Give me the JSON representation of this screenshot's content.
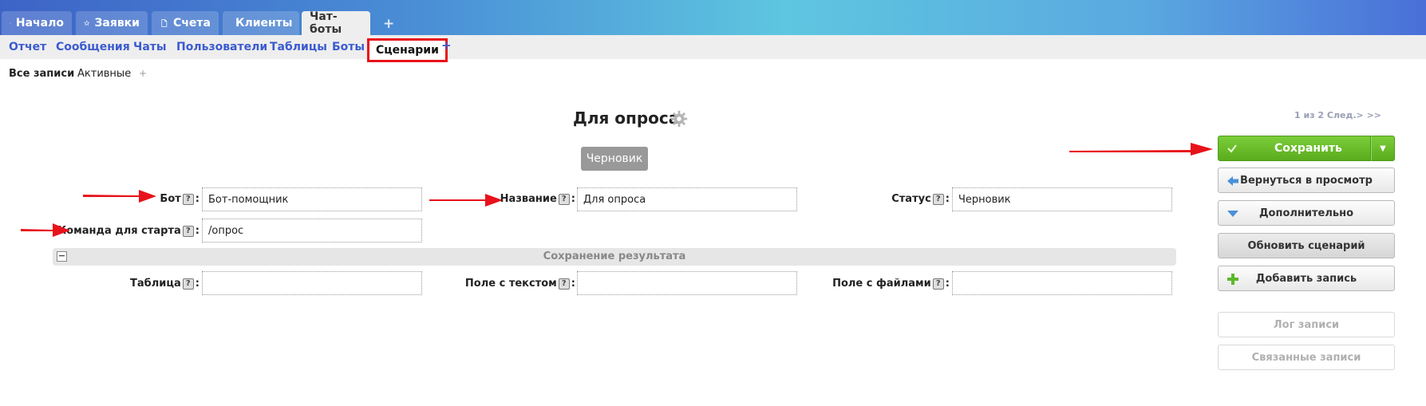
{
  "top_tabs": [
    {
      "label": "Начало",
      "icon": "home-icon"
    },
    {
      "label": "Заявки",
      "icon": "star-icon"
    },
    {
      "label": "Счета",
      "icon": "document-icon"
    },
    {
      "label": "Клиенты",
      "icon": "copy-icon"
    },
    {
      "label": "Чат-боты",
      "icon": ""
    }
  ],
  "top_plus": "+",
  "subnav": [
    "Отчет",
    "Сообщения",
    "Чаты",
    "Пользователи",
    "Таблицы",
    "Боты",
    "Сценарии"
  ],
  "subnav_plus": "+",
  "filters": {
    "all": "Все записи",
    "active": "Активные",
    "plus": "+"
  },
  "title": "Для опроса",
  "pager": "1 из 2 След.> >>",
  "status_badge": "Черновик",
  "fields": {
    "bot": {
      "label": "Бот",
      "value": "Бот-помощник"
    },
    "name": {
      "label": "Название",
      "value": "Для опроса"
    },
    "status": {
      "label": "Статус",
      "value": "Черновик"
    },
    "start_command": {
      "label": "Команда для старта",
      "value": "/опрос"
    },
    "table": {
      "label": "Таблица",
      "value": ""
    },
    "text_field": {
      "label": "Поле с текстом",
      "value": ""
    },
    "files_field": {
      "label": "Поле с файлами",
      "value": ""
    }
  },
  "help_glyph": "?",
  "colon": ":",
  "section": {
    "title": "Сохранение результата",
    "toggle": "−"
  },
  "buttons": {
    "save": "Сохранить",
    "save_caret": "▼",
    "back": "Вернуться в просмотр",
    "more": "Дополнительно",
    "refresh": "Обновить сценарий",
    "add": "Добавить запись",
    "log": "Лог записи",
    "related": "Связанные записи"
  },
  "colors": {
    "accent_blue": "#3b5bd0",
    "save_green": "#6abf2c",
    "highlight_red": "#e8121a"
  }
}
